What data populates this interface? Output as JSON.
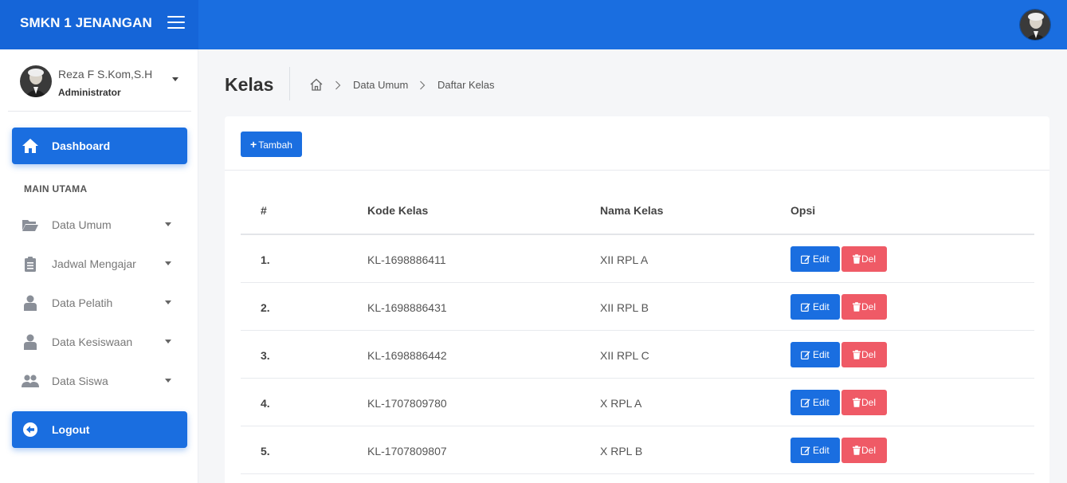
{
  "brand": {
    "name": "SMKN 1 JENANGAN"
  },
  "user": {
    "name": "Reza F S.Kom,S.H",
    "role": "Administrator"
  },
  "sidebar": {
    "dashboard_label": "Dashboard",
    "section_title": "MAIN UTAMA",
    "items": [
      {
        "label": "Data Umum",
        "icon": "folder-open-icon"
      },
      {
        "label": "Jadwal Mengajar",
        "icon": "clipboard-icon"
      },
      {
        "label": "Data Pelatih",
        "icon": "user-icon"
      },
      {
        "label": "Data Kesiswaan",
        "icon": "user-icon"
      },
      {
        "label": "Data Siswa",
        "icon": "users-icon"
      }
    ],
    "logout_label": "Logout"
  },
  "page": {
    "title": "Kelas",
    "breadcrumb": [
      "Data Umum",
      "Daftar Kelas"
    ]
  },
  "toolbar": {
    "add_label": "Tambah"
  },
  "table": {
    "headers": [
      "#",
      "Kode Kelas",
      "Nama Kelas",
      "Opsi"
    ],
    "rows": [
      {
        "no": "1.",
        "kode": "KL-1698886411",
        "nama": "XII RPL A"
      },
      {
        "no": "2.",
        "kode": "KL-1698886431",
        "nama": "XII RPL B"
      },
      {
        "no": "3.",
        "kode": "KL-1698886442",
        "nama": "XII RPL C"
      },
      {
        "no": "4.",
        "kode": "KL-1707809780",
        "nama": "X RPL A"
      },
      {
        "no": "5.",
        "kode": "KL-1707809807",
        "nama": "X RPL B"
      }
    ],
    "edit_label": "Edit",
    "del_label": "Del"
  },
  "colors": {
    "primary": "#1a6ee0",
    "danger": "#ef5a66",
    "background": "#f5f6f8"
  }
}
